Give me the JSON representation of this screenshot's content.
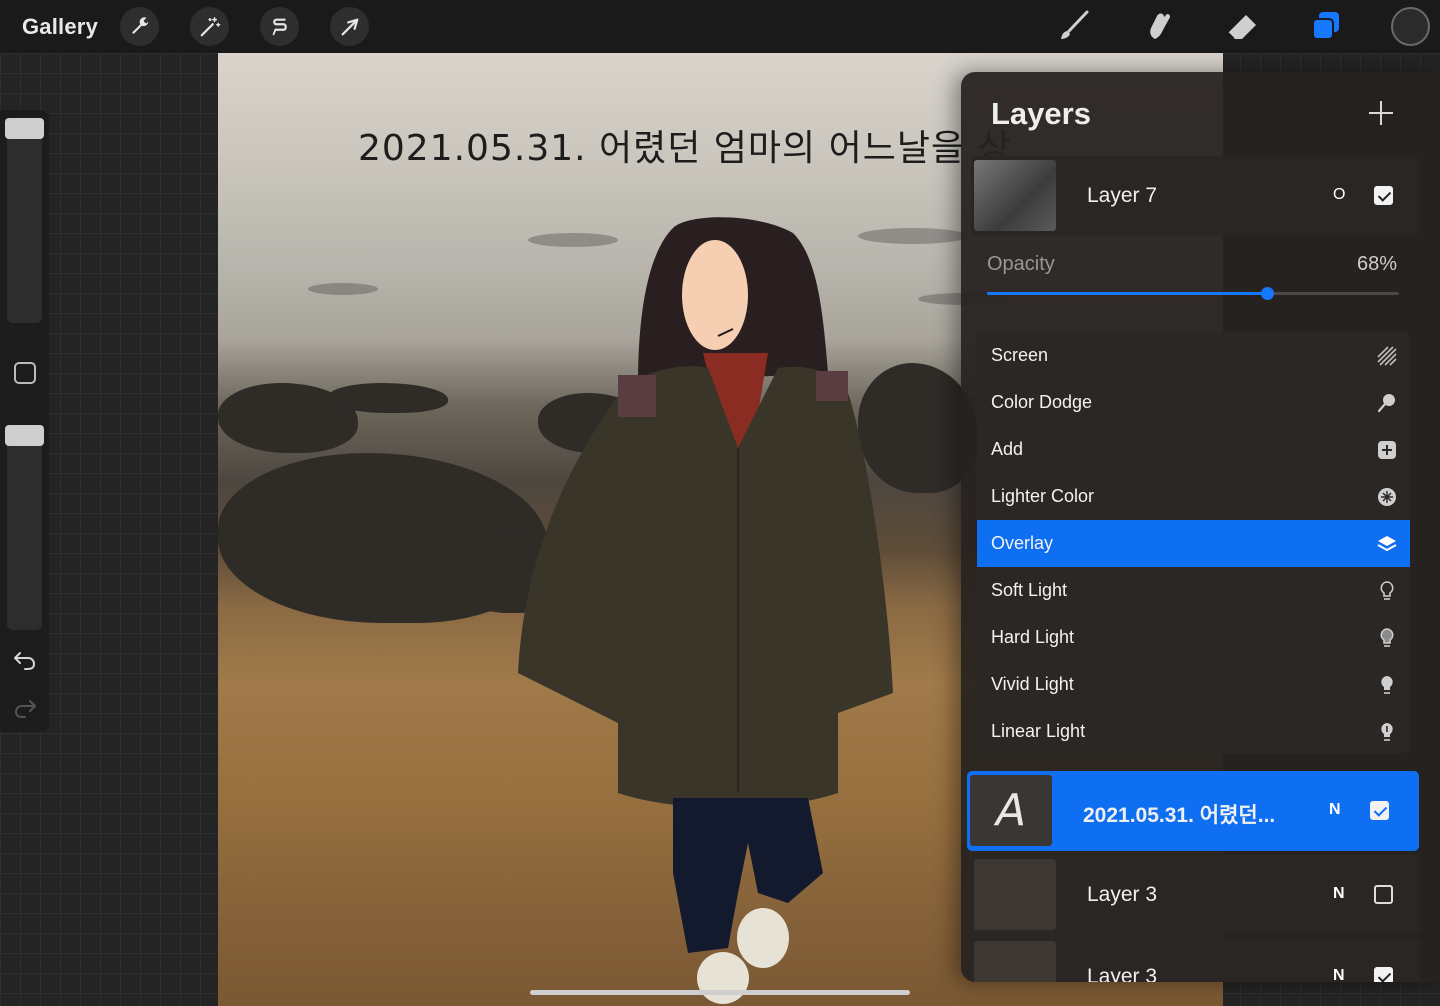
{
  "toolbar": {
    "gallery_label": "Gallery",
    "left_tools": [
      "wrench-icon",
      "magic-wand-icon",
      "selection-icon",
      "transform-arrow-icon"
    ],
    "right_tools": [
      "brush-icon",
      "smudge-icon",
      "eraser-icon",
      "layers-icon"
    ],
    "active_tool": "layers-icon",
    "current_color": "#2b2b2b"
  },
  "sidebar": {
    "brush_size_level": 0.0,
    "brush_opacity_level": 0.0,
    "modifier_icon": "square-modifier-icon",
    "undo_icon": "undo-icon",
    "redo_icon": "redo-icon"
  },
  "canvas": {
    "title_text": "2021.05.31. 어렸던 엄마의 어느날을 상"
  },
  "layers": {
    "title": "Layers",
    "add_icon": "plus-icon",
    "items": [
      {
        "name": "Layer 7",
        "mode": "O",
        "visible": true,
        "selected": false
      },
      {
        "name": "2021.05.31. 어렸던...",
        "mode": "N",
        "visible": true,
        "selected": true,
        "thumb_glyph": "A"
      },
      {
        "name": "Layer 3",
        "mode": "N",
        "visible": false,
        "selected": false
      },
      {
        "name": "Layer 3",
        "mode": "N",
        "visible": true,
        "selected": false
      }
    ],
    "opacity": {
      "label": "Opacity",
      "value_text": "68%",
      "value": 68
    },
    "blend_modes": [
      {
        "label": "Screen",
        "icon": "hatch-icon"
      },
      {
        "label": "Color Dodge",
        "icon": "dodge-icon"
      },
      {
        "label": "Add",
        "icon": "plus-square-icon"
      },
      {
        "label": "Lighter Color",
        "icon": "sparkle-icon"
      },
      {
        "label": "Overlay",
        "icon": "layers-stack-icon",
        "active": true
      },
      {
        "label": "Soft Light",
        "icon": "bulb-outline-icon"
      },
      {
        "label": "Hard Light",
        "icon": "bulb-half-icon"
      },
      {
        "label": "Vivid Light",
        "icon": "bulb-filled-icon"
      },
      {
        "label": "Linear Light",
        "icon": "bulb-glow-icon"
      }
    ],
    "accent_color": "#0f6ff2"
  }
}
